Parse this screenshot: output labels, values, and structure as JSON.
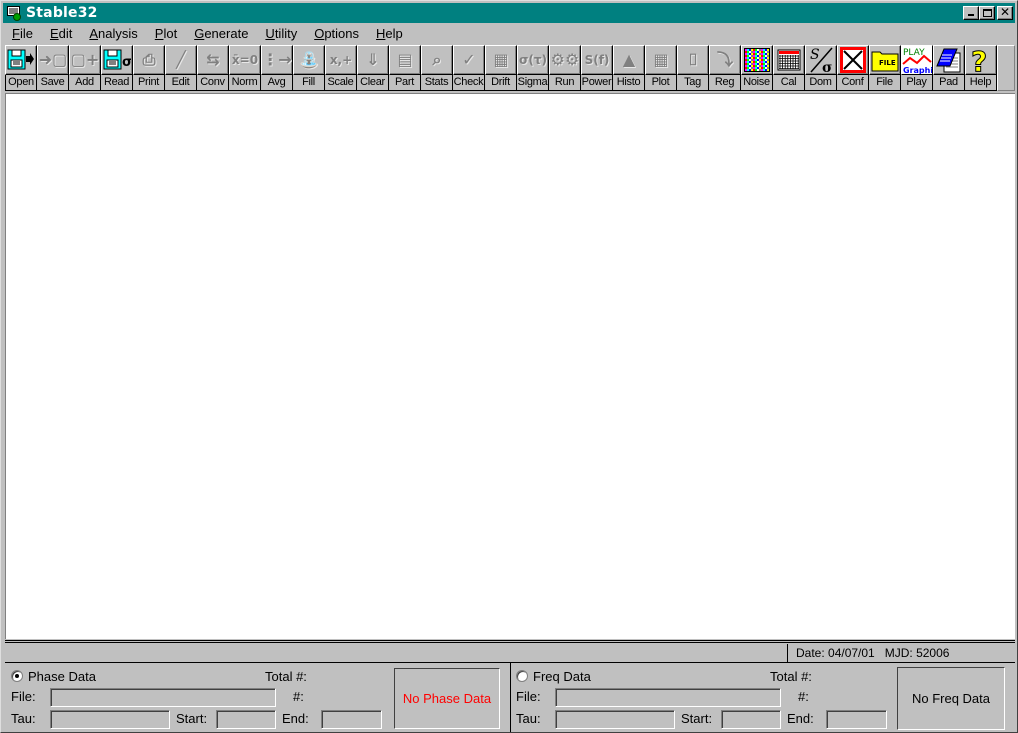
{
  "window": {
    "title": "Stable32",
    "controls": {
      "minimize": "_",
      "maximize": "□",
      "close": "✕"
    }
  },
  "menu": [
    {
      "label": "File",
      "accel": "F",
      "rest": "ile"
    },
    {
      "label": "Edit",
      "accel": "E",
      "rest": "dit"
    },
    {
      "label": "Analysis",
      "accel": "A",
      "rest": "nalysis"
    },
    {
      "label": "Plot",
      "accel": "P",
      "rest": "lot"
    },
    {
      "label": "Generate",
      "accel": "G",
      "rest": "enerate"
    },
    {
      "label": "Utility",
      "accel": "U",
      "rest": "tility"
    },
    {
      "label": "Options",
      "accel": "O",
      "rest": "ptions"
    },
    {
      "label": "Help",
      "accel": "H",
      "rest": "elp"
    }
  ],
  "toolbar": [
    {
      "label": "Open",
      "icon": "open-floppy-icon",
      "glyph": "💾➜",
      "enabled": true
    },
    {
      "label": "Save",
      "icon": "save-icon",
      "glyph": "➜▢",
      "enabled": false
    },
    {
      "label": "Add",
      "icon": "add-icon",
      "glyph": "▢+",
      "enabled": false
    },
    {
      "label": "Read",
      "icon": "read-floppy-icon",
      "glyph": "σ",
      "enabled": true
    },
    {
      "label": "Print",
      "icon": "printer-icon",
      "glyph": "⎙",
      "enabled": false
    },
    {
      "label": "Edit",
      "icon": "pencil-icon",
      "glyph": "╱",
      "enabled": false
    },
    {
      "label": "Conv",
      "icon": "convert-arrows-icon",
      "glyph": "⇆",
      "enabled": false
    },
    {
      "label": "Norm",
      "icon": "normalize-icon",
      "glyph": "x̄=0",
      "enabled": false
    },
    {
      "label": "Avg",
      "icon": "average-icon",
      "glyph": "⋮→",
      "enabled": false
    },
    {
      "label": "Fill",
      "icon": "faucet-icon",
      "glyph": "⛲",
      "enabled": false
    },
    {
      "label": "Scale",
      "icon": "scale-icon",
      "glyph": "x,+",
      "enabled": false
    },
    {
      "label": "Clear",
      "icon": "clear-icon",
      "glyph": "⇓",
      "enabled": false
    },
    {
      "label": "Part",
      "icon": "part-icon",
      "glyph": "▤",
      "enabled": false
    },
    {
      "label": "Stats",
      "icon": "magnifier-icon",
      "glyph": "⌕",
      "enabled": false
    },
    {
      "label": "Check",
      "icon": "checkmark-icon",
      "glyph": "✓",
      "enabled": false
    },
    {
      "label": "Drift",
      "icon": "drift-grid-icon",
      "glyph": "▦",
      "enabled": false
    },
    {
      "label": "Sigma",
      "icon": "sigma-tau-icon",
      "glyph": "σ(τ)",
      "enabled": false
    },
    {
      "label": "Run",
      "icon": "gears-icon",
      "glyph": "⚙⚙",
      "enabled": false
    },
    {
      "label": "Power",
      "icon": "power-spectrum-icon",
      "glyph": "S(f)",
      "enabled": false
    },
    {
      "label": "Histo",
      "icon": "histogram-icon",
      "glyph": "▲",
      "enabled": false
    },
    {
      "label": "Plot",
      "icon": "plot-grid-icon",
      "glyph": "▦",
      "enabled": false
    },
    {
      "label": "Tag",
      "icon": "mouse-icon",
      "glyph": "⌷",
      "enabled": false
    },
    {
      "label": "Reg",
      "icon": "regression-icon",
      "glyph": "⤵",
      "enabled": false
    },
    {
      "label": "Noise",
      "icon": "noise-icon",
      "glyph": "",
      "enabled": true
    },
    {
      "label": "Cal",
      "icon": "calendar-icon",
      "glyph": "",
      "enabled": true
    },
    {
      "label": "Dom",
      "icon": "s-over-sigma-icon",
      "glyph": "",
      "enabled": true
    },
    {
      "label": "Conf",
      "icon": "config-x-icon",
      "glyph": "",
      "enabled": true
    },
    {
      "label": "File",
      "icon": "file-folder-icon",
      "glyph": "FILE",
      "enabled": true
    },
    {
      "label": "Play",
      "icon": "play-graphic-icon",
      "glyph": "",
      "enabled": true
    },
    {
      "label": "Pad",
      "icon": "notepad-icon",
      "glyph": "",
      "enabled": true
    },
    {
      "label": "Help",
      "icon": "question-mark-icon",
      "glyph": "?",
      "enabled": true
    }
  ],
  "play_icon": {
    "top": "PLAY",
    "bottom": "GraphiC"
  },
  "status": {
    "date_label": "Date:",
    "date": "04/07/01",
    "mjd_label": "MJD:",
    "mjd": "52006",
    "date_text": "Date: 04/07/01",
    "mjd_text": "MJD: 52006"
  },
  "phase_panel": {
    "radio_label": "Phase Data",
    "selected": true,
    "total_label": "Total #:",
    "file_label": "File:",
    "count_label": "#:",
    "tau_label": "Tau:",
    "start_label": "Start:",
    "end_label": "End:",
    "file_value": "",
    "tau_value": "",
    "start_value": "",
    "end_value": "",
    "status_text": "No Phase Data",
    "status_color": "#ff0000"
  },
  "freq_panel": {
    "radio_label": "Freq Data",
    "selected": false,
    "total_label": "Total #:",
    "file_label": "File:",
    "count_label": "#:",
    "tau_label": "Tau:",
    "start_label": "Start:",
    "end_label": "End:",
    "file_value": "",
    "tau_value": "",
    "start_value": "",
    "end_value": "",
    "status_text": "No Freq Data",
    "status_color": "#000000"
  }
}
